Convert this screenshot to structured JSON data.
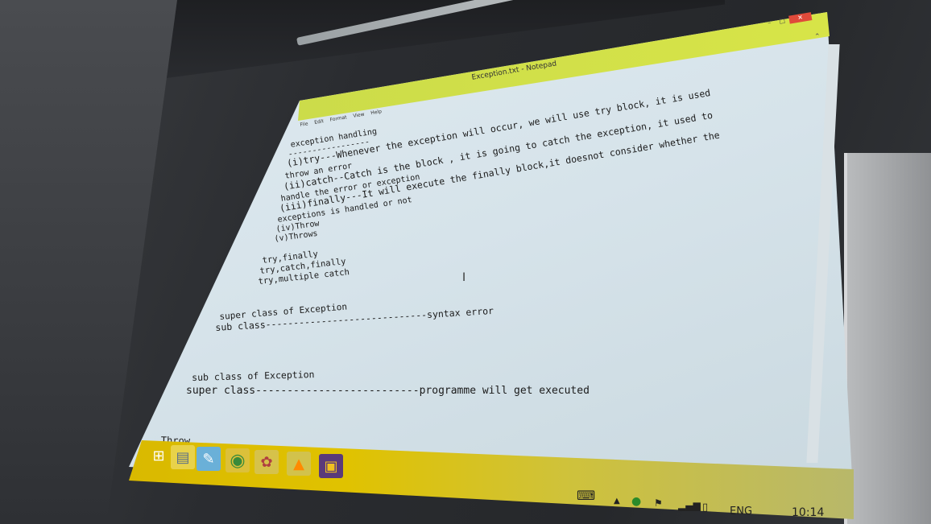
{
  "window": {
    "title": "Exception.txt - Notepad",
    "controls": [
      "–",
      "□",
      "✕"
    ]
  },
  "menu": [
    "File",
    "Edit",
    "Format",
    "View",
    "Help"
  ],
  "editor_lines": [
    "exception handling",
    "-----------------",
    "(i)try---Whenever the exception will occur, we will use try block, it is used",
    "throw an error",
    "(ii)catch--Catch is the block , it is going to catch the exception, it used to",
    "handle the error or exception",
    "(iii)finally---It will execute the finally block,it doesnot consider whether the",
    "exceptions is handled or not",
    "(iv)Throw",
    "(v)Throws",
    "try,finally",
    "try,catch,finally",
    "try,multiple catch",
    "super class of Exception",
    "sub class-----------------------------syntax error",
    "sub class of Exception",
    "super class--------------------------programme will get executed",
    "Throw"
  ],
  "taskbar": {
    "apps": [
      {
        "name": "start-icon",
        "glyph": "⊞"
      },
      {
        "name": "file-explorer-icon",
        "glyph": "▤"
      },
      {
        "name": "notepad-icon",
        "glyph": "✎"
      },
      {
        "name": "chrome-icon",
        "glyph": "◉"
      },
      {
        "name": "paint-icon",
        "glyph": "🎨"
      },
      {
        "name": "vlc-icon",
        "glyph": "▲"
      },
      {
        "name": "winrar-icon",
        "glyph": "▣"
      }
    ],
    "tray": {
      "language": "ENG",
      "time": "10:14"
    }
  },
  "colors": {
    "titlebar": "#d8e548",
    "taskbar": "#e0c200",
    "editor_bg": "#dbe7ee",
    "close_button": "#e04a3a"
  }
}
